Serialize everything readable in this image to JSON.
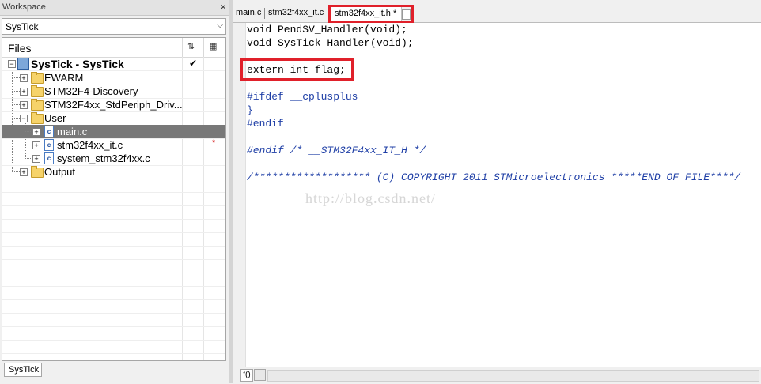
{
  "workspace": {
    "title": "Workspace",
    "close_glyph": "×",
    "config": {
      "value": "SysTick"
    },
    "files_label": "Files",
    "header_icons": [
      "sync-icon",
      "options-icon"
    ],
    "tree": [
      {
        "label": "SysTick - SysTick",
        "type": "project",
        "checked": true
      },
      {
        "label": "EWARM",
        "type": "folder"
      },
      {
        "label": "STM32F4-Discovery",
        "type": "folder"
      },
      {
        "label": "STM32F4xx_StdPeriph_Driv...",
        "type": "folder"
      },
      {
        "label": "User",
        "type": "folder",
        "expanded": true
      },
      {
        "label": "main.c",
        "type": "file",
        "selected": true
      },
      {
        "label": "stm32f4xx_it.c",
        "type": "file",
        "modified": true
      },
      {
        "label": "system_stm32f4xx.c",
        "type": "file"
      },
      {
        "label": "Output",
        "type": "folder"
      }
    ],
    "bottom_tab": "SysTick"
  },
  "editor": {
    "tabs": [
      {
        "label": "main.c"
      },
      {
        "label": "stm32f4xx_it.c"
      },
      {
        "label": "stm32f4xx_it.h *",
        "active": true
      }
    ],
    "code": {
      "line1": "void PendSV_Handler(void);",
      "line2": "void SysTick_Handler(void);",
      "line3": "extern int flag;",
      "line4": "#ifdef __cplusplus",
      "line5": "}",
      "line6": "#endif",
      "line7": "#endif /* __STM32F4xx_IT_H */",
      "line8": "/******************* (C) COPYRIGHT 2011 STMicroelectronics *****END OF FILE****/"
    },
    "watermark": "http://blog.csdn.net/",
    "status_f0": "f()"
  },
  "colors": {
    "highlight_red": "#e0202a",
    "selected_row": "#787878",
    "preprocessor_blue": "#1f3fa6"
  }
}
